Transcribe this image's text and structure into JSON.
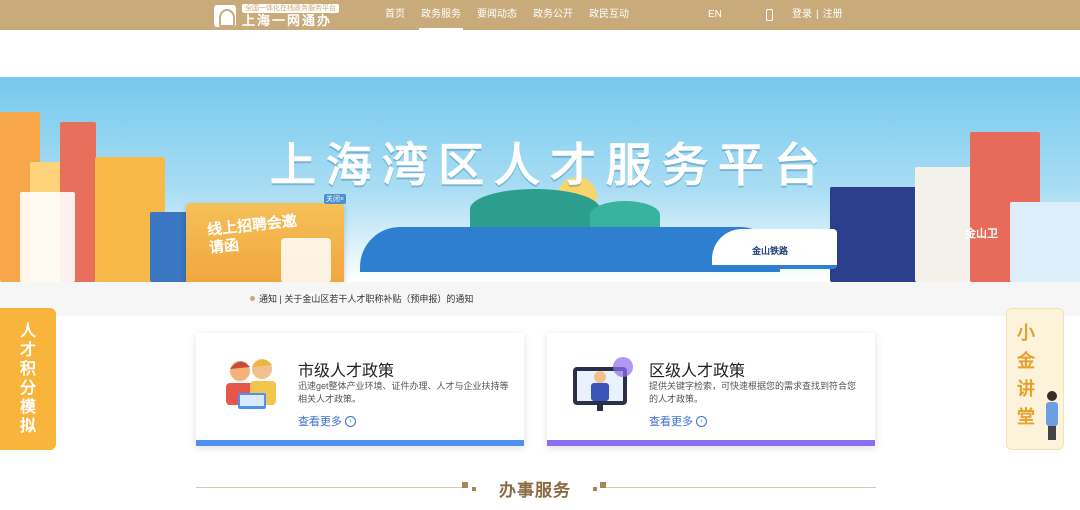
{
  "header": {
    "logo_sub": "全国一体化在线政务服务平台",
    "logo_main": "上海一网通办",
    "nav": [
      "首页",
      "政务服务",
      "要闻动态",
      "政务公开",
      "政民互动"
    ],
    "active_nav": "政务服务",
    "lang": "EN",
    "login": "登录",
    "separator": "|",
    "register": "注册"
  },
  "banner": {
    "title": "上海湾区人才服务平台",
    "train_label": "金山铁路",
    "town_label": "金山卫"
  },
  "popup": {
    "title": "线上招聘会邀请函",
    "close": "关闭×"
  },
  "notice": {
    "text": "通知 | 关于金山区若干人才职称补贴（预申报）的通知"
  },
  "floats": {
    "left": "人才积分模拟",
    "right": "小金讲堂"
  },
  "cards": [
    {
      "title": "市级人才政策",
      "desc": "迅速get整体产业环境、证件办理、人才与企业扶持等相关人才政策。",
      "more": "查看更多"
    },
    {
      "title": "区级人才政策",
      "desc": "提供关键字检索，可快速根据您的需求查找到符合您的人才政策。",
      "more": "查看更多"
    }
  ],
  "section": {
    "title": "办事服务"
  },
  "colors": {
    "brand_gold": "#c9aa7a",
    "city_card_accent": "#4f90f0",
    "district_card_accent": "#8e6df0",
    "left_float": "#f8b43b"
  }
}
